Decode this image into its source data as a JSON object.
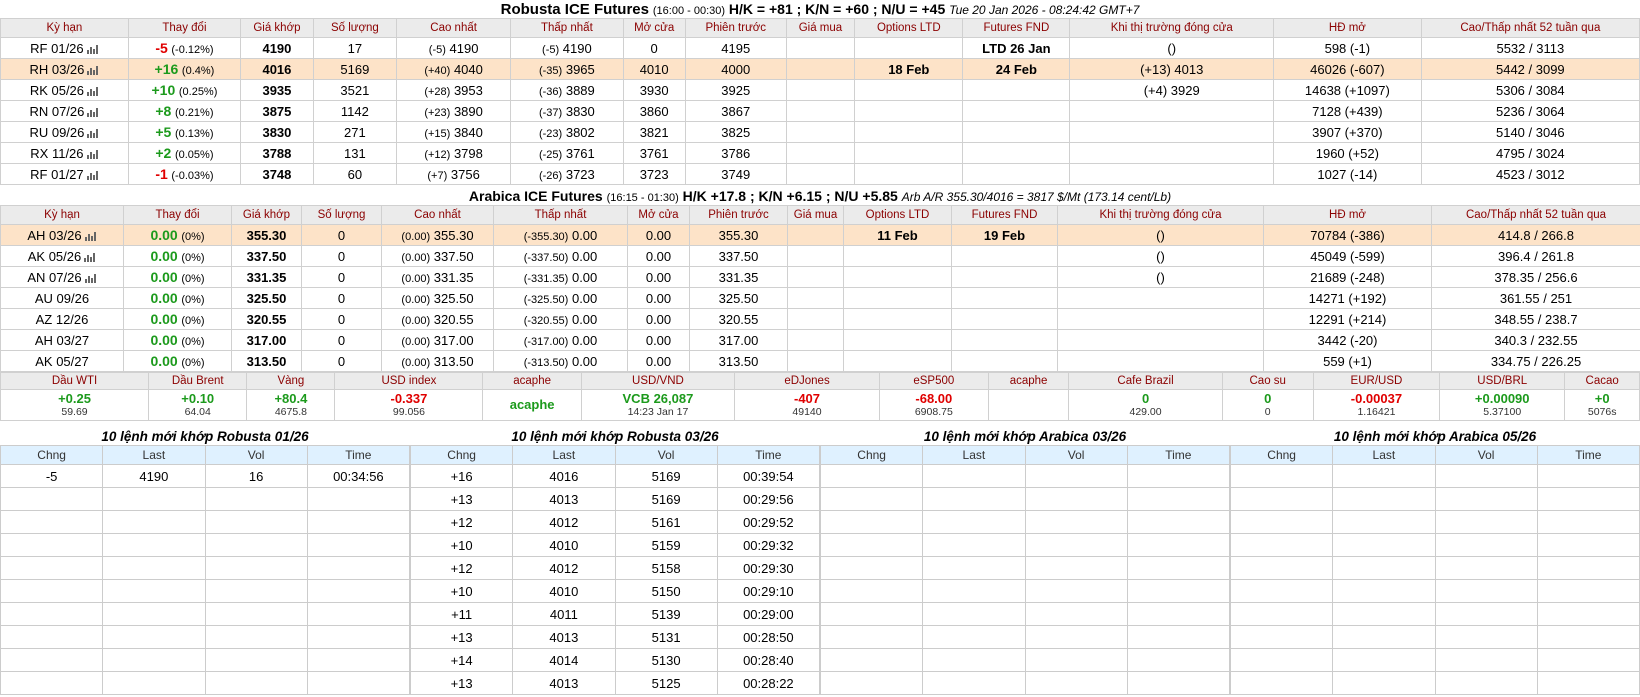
{
  "robusta": {
    "title": "Robusta ICE Futures",
    "hours": "(16:00 - 00:30)",
    "spreads": "H/K = +81 ; K/N = +60 ; N/U = +45",
    "datetime": "Tue 20 Jan 2026 - 08:24:42 GMT+7",
    "headers": [
      "Kỳ hạn",
      "Thay đổi",
      "Giá khớp",
      "Số lượng",
      "Cao nhất",
      "Thấp nhất",
      "Mở cửa",
      "Phiên trước",
      "Giá mua",
      "Options LTD",
      "Futures FND",
      "Khi thị trường đóng cửa",
      "HĐ mở",
      "Cao/Thấp nhất 52 tuần qua"
    ],
    "rows": [
      {
        "term": "RF 01/26",
        "chg": "-5",
        "pct": "(-0.12%)",
        "dir": "down",
        "last": "4190",
        "vol": "17",
        "high_c": "(-5)",
        "high": "4190",
        "low_c": "(-5)",
        "low": "4190",
        "open": "0",
        "prev": "4195",
        "bid": "",
        "opt": "",
        "fnd": "LTD 26 Jan",
        "close": "()",
        "oi": "598 (-1)",
        "range": "5532 / 3113",
        "hl": false
      },
      {
        "term": "RH 03/26",
        "chg": "+16",
        "pct": "(0.4%)",
        "dir": "up",
        "last": "4016",
        "vol": "5169",
        "high_c": "(+40)",
        "high": "4040",
        "low_c": "(-35)",
        "low": "3965",
        "open": "4010",
        "prev": "4000",
        "bid": "",
        "opt": "18 Feb",
        "fnd": "24 Feb",
        "close": "(+13) 4013",
        "oi": "46026 (-607)",
        "range": "5442 / 3099",
        "hl": true
      },
      {
        "term": "RK 05/26",
        "chg": "+10",
        "pct": "(0.25%)",
        "dir": "up",
        "last": "3935",
        "vol": "3521",
        "high_c": "(+28)",
        "high": "3953",
        "low_c": "(-36)",
        "low": "3889",
        "open": "3930",
        "prev": "3925",
        "bid": "",
        "opt": "",
        "fnd": "",
        "close": "(+4) 3929",
        "oi": "14638 (+1097)",
        "range": "5306 / 3084",
        "hl": false
      },
      {
        "term": "RN 07/26",
        "chg": "+8",
        "pct": "(0.21%)",
        "dir": "up",
        "last": "3875",
        "vol": "1142",
        "high_c": "(+23)",
        "high": "3890",
        "low_c": "(-37)",
        "low": "3830",
        "open": "3860",
        "prev": "3867",
        "bid": "",
        "opt": "",
        "fnd": "",
        "close": "",
        "oi": "7128 (+439)",
        "range": "5236 / 3064",
        "hl": false
      },
      {
        "term": "RU 09/26",
        "chg": "+5",
        "pct": "(0.13%)",
        "dir": "up",
        "last": "3830",
        "vol": "271",
        "high_c": "(+15)",
        "high": "3840",
        "low_c": "(-23)",
        "low": "3802",
        "open": "3821",
        "prev": "3825",
        "bid": "",
        "opt": "",
        "fnd": "",
        "close": "",
        "oi": "3907 (+370)",
        "range": "5140 / 3046",
        "hl": false
      },
      {
        "term": "RX 11/26",
        "chg": "+2",
        "pct": "(0.05%)",
        "dir": "up",
        "last": "3788",
        "vol": "131",
        "high_c": "(+12)",
        "high": "3798",
        "low_c": "(-25)",
        "low": "3761",
        "open": "3761",
        "prev": "3786",
        "bid": "",
        "opt": "",
        "fnd": "",
        "close": "",
        "oi": "1960 (+52)",
        "range": "4795 / 3024",
        "hl": false
      },
      {
        "term": "RF 01/27",
        "chg": "-1",
        "pct": "(-0.03%)",
        "dir": "down",
        "last": "3748",
        "vol": "60",
        "high_c": "(+7)",
        "high": "3756",
        "low_c": "(-26)",
        "low": "3723",
        "open": "3723",
        "prev": "3749",
        "bid": "",
        "opt": "",
        "fnd": "",
        "close": "",
        "oi": "1027 (-14)",
        "range": "4523 / 3012",
        "hl": false
      }
    ]
  },
  "arabica": {
    "title": "Arabica ICE Futures",
    "hours": "(16:15 - 01:30)",
    "spreads": "H/K +17.8 ; K/N +6.15 ; N/U +5.85",
    "arb": "Arb A/R 355.30/4016 = 3817 $/Mt (173.14 cent/Lb)",
    "headers": [
      "Kỳ hạn",
      "Thay đổi",
      "Giá khớp",
      "Số lượng",
      "Cao nhất",
      "Thấp nhất",
      "Mở cửa",
      "Phiên trước",
      "Giá mua",
      "Options LTD",
      "Futures FND",
      "Khi thị trường đóng cửa",
      "HĐ mở",
      "Cao/Thấp nhất 52 tuần qua"
    ],
    "rows": [
      {
        "term": "AH 03/26",
        "chg": "0.00",
        "pct": "(0%)",
        "dir": "flat",
        "last": "355.30",
        "vol": "0",
        "high_c": "(0.00)",
        "high": "355.30",
        "low_c": "(-355.30)",
        "low": "0.00",
        "open": "0.00",
        "prev": "355.30",
        "bid": "",
        "opt": "11 Feb",
        "fnd": "19 Feb",
        "close": "()",
        "oi": "70784 (-386)",
        "range": "414.8 / 266.8",
        "hl": true,
        "icon": true
      },
      {
        "term": "AK 05/26",
        "chg": "0.00",
        "pct": "(0%)",
        "dir": "flat",
        "last": "337.50",
        "vol": "0",
        "high_c": "(0.00)",
        "high": "337.50",
        "low_c": "(-337.50)",
        "low": "0.00",
        "open": "0.00",
        "prev": "337.50",
        "bid": "",
        "opt": "",
        "fnd": "",
        "close": "()",
        "oi": "45049 (-599)",
        "range": "396.4 / 261.8",
        "hl": false,
        "icon": true
      },
      {
        "term": "AN 07/26",
        "chg": "0.00",
        "pct": "(0%)",
        "dir": "flat",
        "last": "331.35",
        "vol": "0",
        "high_c": "(0.00)",
        "high": "331.35",
        "low_c": "(-331.35)",
        "low": "0.00",
        "open": "0.00",
        "prev": "331.35",
        "bid": "",
        "opt": "",
        "fnd": "",
        "close": "()",
        "oi": "21689 (-248)",
        "range": "378.35 / 256.6",
        "hl": false,
        "icon": true
      },
      {
        "term": "AU 09/26",
        "chg": "0.00",
        "pct": "(0%)",
        "dir": "flat",
        "last": "325.50",
        "vol": "0",
        "high_c": "(0.00)",
        "high": "325.50",
        "low_c": "(-325.50)",
        "low": "0.00",
        "open": "0.00",
        "prev": "325.50",
        "bid": "",
        "opt": "",
        "fnd": "",
        "close": "",
        "oi": "14271 (+192)",
        "range": "361.55 / 251",
        "hl": false,
        "icon": false
      },
      {
        "term": "AZ 12/26",
        "chg": "0.00",
        "pct": "(0%)",
        "dir": "flat",
        "last": "320.55",
        "vol": "0",
        "high_c": "(0.00)",
        "high": "320.55",
        "low_c": "(-320.55)",
        "low": "0.00",
        "open": "0.00",
        "prev": "320.55",
        "bid": "",
        "opt": "",
        "fnd": "",
        "close": "",
        "oi": "12291 (+214)",
        "range": "348.55 / 238.7",
        "hl": false,
        "icon": false
      },
      {
        "term": "AH 03/27",
        "chg": "0.00",
        "pct": "(0%)",
        "dir": "flat",
        "last": "317.00",
        "vol": "0",
        "high_c": "(0.00)",
        "high": "317.00",
        "low_c": "(-317.00)",
        "low": "0.00",
        "open": "0.00",
        "prev": "317.00",
        "bid": "",
        "opt": "",
        "fnd": "",
        "close": "",
        "oi": "3442 (-20)",
        "range": "340.3 / 232.55",
        "hl": false,
        "icon": false
      },
      {
        "term": "AK 05/27",
        "chg": "0.00",
        "pct": "(0%)",
        "dir": "flat",
        "last": "313.50",
        "vol": "0",
        "high_c": "(0.00)",
        "high": "313.50",
        "low_c": "(-313.50)",
        "low": "0.00",
        "open": "0.00",
        "prev": "313.50",
        "bid": "",
        "opt": "",
        "fnd": "",
        "close": "",
        "oi": "559 (+1)",
        "range": "334.75 / 226.25",
        "hl": false,
        "icon": false
      }
    ]
  },
  "markets": [
    {
      "label": "Dầu WTI",
      "value": "+0.25",
      "sub": "59.69",
      "color": "#1c9a1c"
    },
    {
      "label": "Dầu Brent",
      "value": "+0.10",
      "sub": "64.04",
      "color": "#1c9a1c"
    },
    {
      "label": "Vàng",
      "value": "+80.4",
      "sub": "4675.8",
      "color": "#1c9a1c"
    },
    {
      "label": "USD index",
      "value": "-0.337",
      "sub": "99.056",
      "color": "#e00000"
    },
    {
      "label": "acaphe",
      "value": "acaphe",
      "sub": "",
      "color": "#1c9a1c"
    },
    {
      "label": "USD/VND",
      "value": "VCB 26,087",
      "sub": "14:23 Jan 17",
      "color": "#1c9a1c"
    },
    {
      "label": "eDJones",
      "value": "-407",
      "sub": "49140",
      "color": "#e00000"
    },
    {
      "label": "eSP500",
      "value": "-68.00",
      "sub": "6908.75",
      "color": "#e00000"
    },
    {
      "label": "acaphe",
      "value": "",
      "sub": "",
      "color": "#1c9a1c"
    },
    {
      "label": "Cafe Brazil",
      "value": "0",
      "sub": "429.00",
      "color": "#1c9a1c"
    },
    {
      "label": "Cao su",
      "value": "0",
      "sub": "0",
      "color": "#1c9a1c"
    },
    {
      "label": "EUR/USD",
      "value": "-0.00037",
      "sub": "1.16421",
      "color": "#e00000"
    },
    {
      "label": "USD/BRL",
      "value": "+0.00090",
      "sub": "5.37100",
      "color": "#1c9a1c"
    },
    {
      "label": "Cacao",
      "value": "+0",
      "sub": "5076s",
      "color": "#1c9a1c"
    }
  ],
  "trades": {
    "col_headers": [
      "Chng",
      "Last",
      "Vol",
      "Time"
    ],
    "boxes": [
      {
        "title": "10 lệnh mới khớp Robusta 01/26",
        "rows": [
          {
            "chng": "-5",
            "last": "4190",
            "vol": "16",
            "time": "00:34:56"
          }
        ]
      },
      {
        "title": "10 lệnh mới khớp Robusta 03/26",
        "rows": [
          {
            "chng": "+16",
            "last": "4016",
            "vol": "5169",
            "time": "00:39:54"
          },
          {
            "chng": "+13",
            "last": "4013",
            "vol": "5169",
            "time": "00:29:56"
          },
          {
            "chng": "+12",
            "last": "4012",
            "vol": "5161",
            "time": "00:29:52"
          },
          {
            "chng": "+10",
            "last": "4010",
            "vol": "5159",
            "time": "00:29:32"
          },
          {
            "chng": "+12",
            "last": "4012",
            "vol": "5158",
            "time": "00:29:30"
          },
          {
            "chng": "+10",
            "last": "4010",
            "vol": "5150",
            "time": "00:29:10"
          },
          {
            "chng": "+11",
            "last": "4011",
            "vol": "5139",
            "time": "00:29:00"
          },
          {
            "chng": "+13",
            "last": "4013",
            "vol": "5131",
            "time": "00:28:50"
          },
          {
            "chng": "+14",
            "last": "4014",
            "vol": "5130",
            "time": "00:28:40"
          },
          {
            "chng": "+13",
            "last": "4013",
            "vol": "5125",
            "time": "00:28:22"
          }
        ]
      },
      {
        "title": "10 lệnh mới khớp Arabica 03/26",
        "rows": []
      },
      {
        "title": "10 lệnh mới khớp Arabica 05/26",
        "rows": []
      }
    ]
  }
}
